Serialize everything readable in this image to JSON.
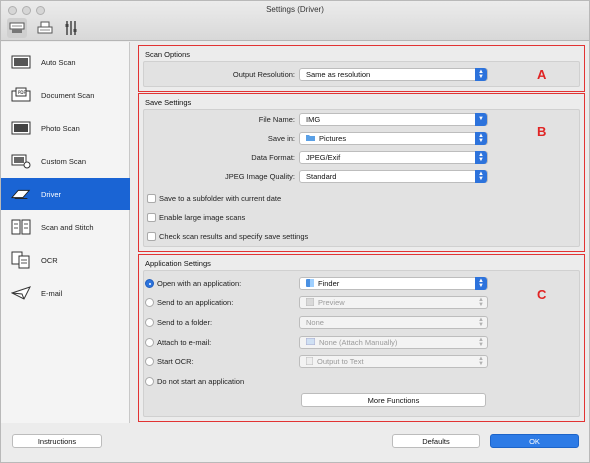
{
  "window": {
    "title": "Settings (Driver)"
  },
  "toolbar": {
    "icons": [
      "scanner-from-computer-icon",
      "scanner-from-operation-panel-icon",
      "general-settings-icon"
    ]
  },
  "sidebar": {
    "items": [
      {
        "label": "Auto Scan",
        "icon": "auto-scan-icon"
      },
      {
        "label": "Document Scan",
        "icon": "document-scan-icon"
      },
      {
        "label": "Photo Scan",
        "icon": "photo-scan-icon"
      },
      {
        "label": "Custom Scan",
        "icon": "custom-scan-icon"
      },
      {
        "label": "Driver",
        "icon": "driver-icon",
        "selected": true
      },
      {
        "label": "Scan and Stitch",
        "icon": "scan-stitch-icon"
      },
      {
        "label": "OCR",
        "icon": "ocr-icon"
      },
      {
        "label": "E-mail",
        "icon": "email-icon"
      }
    ]
  },
  "scan_options": {
    "title": "Scan Options",
    "letter": "A",
    "output_resolution_label": "Output Resolution:",
    "output_resolution_value": "Same as resolution"
  },
  "save_settings": {
    "title": "Save Settings",
    "letter": "B",
    "file_name_label": "File Name:",
    "file_name_value": "IMG",
    "save_in_label": "Save in:",
    "save_in_value": "Pictures",
    "data_format_label": "Data Format:",
    "data_format_value": "JPEG/Exif",
    "jpeg_quality_label": "JPEG Image Quality:",
    "jpeg_quality_value": "Standard",
    "checkbox_subfolder": "Save to a subfolder with current date",
    "checkbox_large": "Enable large image scans",
    "checkbox_check_results": "Check scan results and specify save settings"
  },
  "application_settings": {
    "title": "Application Settings",
    "letter": "C",
    "open_with_label": "Open with an application:",
    "open_with_value": "Finder",
    "send_to_app_label": "Send to an application:",
    "send_to_app_value": "Preview",
    "send_to_folder_label": "Send to a folder:",
    "send_to_folder_value": "None",
    "attach_email_label": "Attach to e-mail:",
    "attach_email_value": "None (Attach Manually)",
    "start_ocr_label": "Start OCR:",
    "start_ocr_value": "Output to Text",
    "no_app_label": "Do not start an application",
    "more_functions": "More Functions"
  },
  "footer": {
    "instructions": "Instructions",
    "defaults": "Defaults",
    "ok": "OK"
  },
  "colors": {
    "accent": "#2d73dc",
    "selection": "#1a64d4",
    "annotation": "#e23333"
  }
}
